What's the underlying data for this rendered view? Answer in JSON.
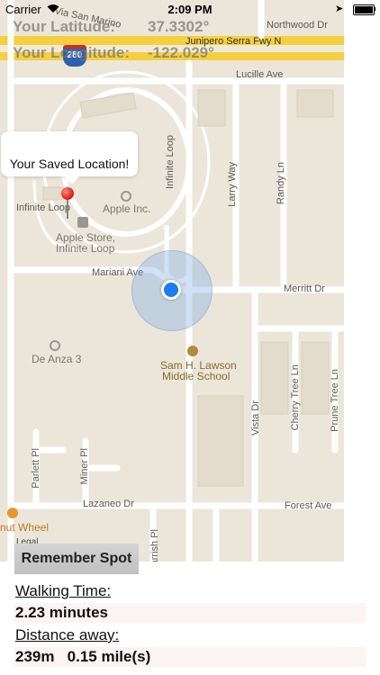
{
  "status_bar": {
    "carrier": "Carrier",
    "time": "2:09 PM",
    "location_glyph": "➤"
  },
  "coordinates": {
    "latitude_label": "Your Latitude:",
    "latitude_value": "37.3302°",
    "longitude_label": "Your Longitude:",
    "longitude_value": "-122.029°"
  },
  "map": {
    "highway_label": "Junipero Serra Fwy N",
    "highway_shield": "280",
    "roads": {
      "via_san_marino": "Via San Marino",
      "northwood_dr": "Northwood Dr",
      "lucille_ave": "Lucille Ave",
      "infinite_loop_v": "Infinite Loop",
      "infinite_loop_h": "Infinite Loop",
      "larry_way": "Larry Way",
      "randy_ln": "Randy Ln",
      "mariani_ave": "Mariani Ave",
      "merritt_dr": "Merritt Dr",
      "vista_dr": "Vista Dr",
      "cherry_tree_ln": "Cherry Tree Ln",
      "prune_tree_ln": "Prune Tree Ln",
      "parlett_pl": "Parlett Pl",
      "miner_pl": "Miner Pl",
      "lazaneo_dr": "Lazaneo Dr",
      "forest_ave": "Forest Ave",
      "parrish_pl": "Parrish Pl"
    },
    "pois": {
      "apple_inc": "Apple Inc.",
      "apple_store_line1": "Apple Store,",
      "apple_store_line2": "Infinite Loop",
      "de_anza": "De Anza 3",
      "school_line1": "Sam H. Lawson",
      "school_line2": "Middle School",
      "nut_wheel": "nut Wheel"
    },
    "legal": "Legal",
    "callout_text": "Your Saved Location!"
  },
  "panel": {
    "remember_button": "Remember Spot",
    "walking_time_label": "Walking Time:",
    "walking_time_value": "2.23 minutes",
    "distance_label": "Distance away:",
    "distance_value": "239m   0.15 mile(s)"
  },
  "colors": {
    "map_background": "#ece6da",
    "highway": "#f6cf3f",
    "road": "#ffffff",
    "user_dot": "#1a7bf2",
    "pin": "#e1251b"
  }
}
